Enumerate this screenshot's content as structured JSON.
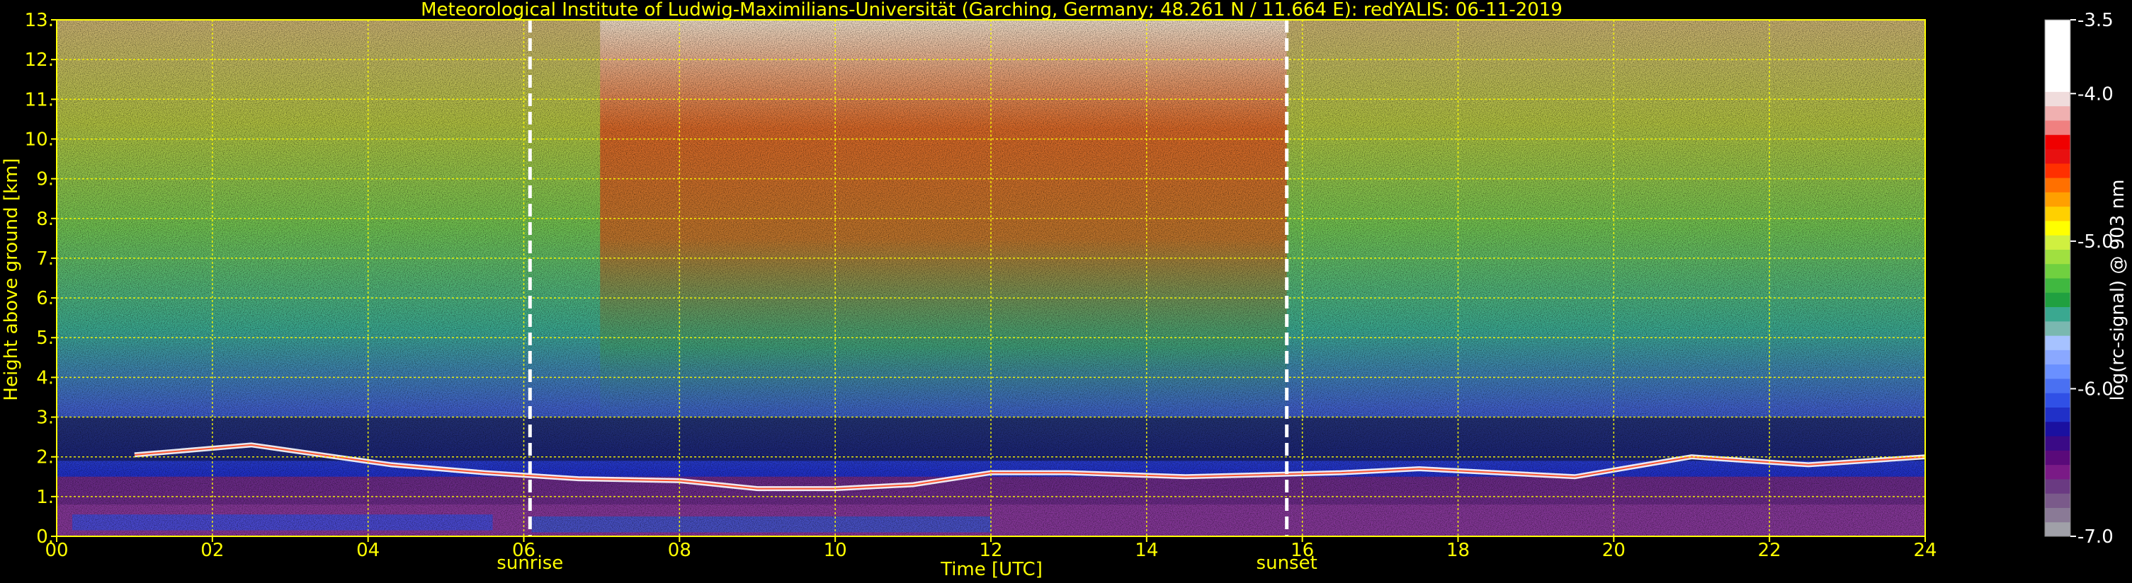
{
  "chart_data": {
    "type": "heatmap",
    "title": "Meteorological Institute of Ludwig-Maximilians-Universität (Garching, Germany; 48.261 N / 11.664 E):    redYALIS: 06-11-2019",
    "xlabel": "Time [UTC]",
    "ylabel": "Height above ground [km]",
    "xlim": [
      0,
      24
    ],
    "ylim": [
      0,
      13
    ],
    "x_ticks": [
      {
        "value": 0,
        "label": "00"
      },
      {
        "value": 2,
        "label": "02"
      },
      {
        "value": 4,
        "label": "04"
      },
      {
        "value": 6,
        "label": "06"
      },
      {
        "value": 8,
        "label": "08"
      },
      {
        "value": 10,
        "label": "10"
      },
      {
        "value": 12,
        "label": "12"
      },
      {
        "value": 14,
        "label": "14"
      },
      {
        "value": 16,
        "label": "16"
      },
      {
        "value": 18,
        "label": "18"
      },
      {
        "value": 20,
        "label": "20"
      },
      {
        "value": 22,
        "label": "22"
      },
      {
        "value": 24,
        "label": "24"
      }
    ],
    "y_ticks": [
      {
        "value": 0,
        "label": "0."
      },
      {
        "value": 1,
        "label": "1."
      },
      {
        "value": 2,
        "label": "2."
      },
      {
        "value": 3,
        "label": "3."
      },
      {
        "value": 4,
        "label": "4."
      },
      {
        "value": 5,
        "label": "5."
      },
      {
        "value": 6,
        "label": "6."
      },
      {
        "value": 7,
        "label": "7."
      },
      {
        "value": 8,
        "label": "8."
      },
      {
        "value": 9,
        "label": "9."
      },
      {
        "value": 10,
        "label": "10."
      },
      {
        "value": 11,
        "label": "11."
      },
      {
        "value": 12,
        "label": "12."
      },
      {
        "value": 13,
        "label": "13."
      }
    ],
    "grid": true,
    "events": [
      {
        "name": "sunrise",
        "time": 6.08
      },
      {
        "name": "sunset",
        "time": 15.8
      }
    ],
    "colorbar": {
      "label": "log(rc-signal) @ 903 nm",
      "range": [
        -7.0,
        -3.5
      ],
      "ticks": [
        {
          "value": -3.5,
          "label": "-3.5"
        },
        {
          "value": -4.0,
          "label": "-4.0"
        },
        {
          "value": -5.0,
          "label": "-5.0"
        },
        {
          "value": -6.0,
          "label": "-6.0"
        },
        {
          "value": -7.0,
          "label": "-7.0"
        }
      ],
      "colors": [
        "#a0a0a8",
        "#8a7a96",
        "#7a5a8a",
        "#6a3a82",
        "#7a1a86",
        "#5a0a7a",
        "#3a0a86",
        "#1a10a0",
        "#2030c8",
        "#3050e6",
        "#4a70f2",
        "#6a90ff",
        "#8aa8ff",
        "#a6c2ff",
        "#7ab8b0",
        "#3aa890",
        "#20a040",
        "#40b840",
        "#70d040",
        "#a0e040",
        "#d0f040",
        "#ffff00",
        "#ffd000",
        "#ffa000",
        "#ff7000",
        "#ff3000",
        "#e81010",
        "#f00000",
        "#f08080",
        "#f0b0b0",
        "#f0dcdc",
        "#ffffff",
        "#ffffff",
        "#ffffff",
        "#ffffff",
        "#ffffff"
      ]
    },
    "cloud_base_heights": [
      {
        "time": 1.0,
        "height": 2.05
      },
      {
        "time": 2.5,
        "height": 2.3
      },
      {
        "time": 4.3,
        "height": 1.8
      },
      {
        "time": 5.5,
        "height": 1.6
      },
      {
        "time": 6.7,
        "height": 1.45
      },
      {
        "time": 8.0,
        "height": 1.4
      },
      {
        "time": 9.0,
        "height": 1.2
      },
      {
        "time": 10.0,
        "height": 1.2
      },
      {
        "time": 11.0,
        "height": 1.3
      },
      {
        "time": 12.0,
        "height": 1.6
      },
      {
        "time": 13.0,
        "height": 1.6
      },
      {
        "time": 14.5,
        "height": 1.5
      },
      {
        "time": 16.5,
        "height": 1.6
      },
      {
        "time": 17.5,
        "height": 1.7
      },
      {
        "time": 19.5,
        "height": 1.5
      },
      {
        "time": 21.0,
        "height": 2.0
      },
      {
        "time": 22.5,
        "height": 1.8
      },
      {
        "time": 24.0,
        "height": 2.0
      }
    ]
  }
}
